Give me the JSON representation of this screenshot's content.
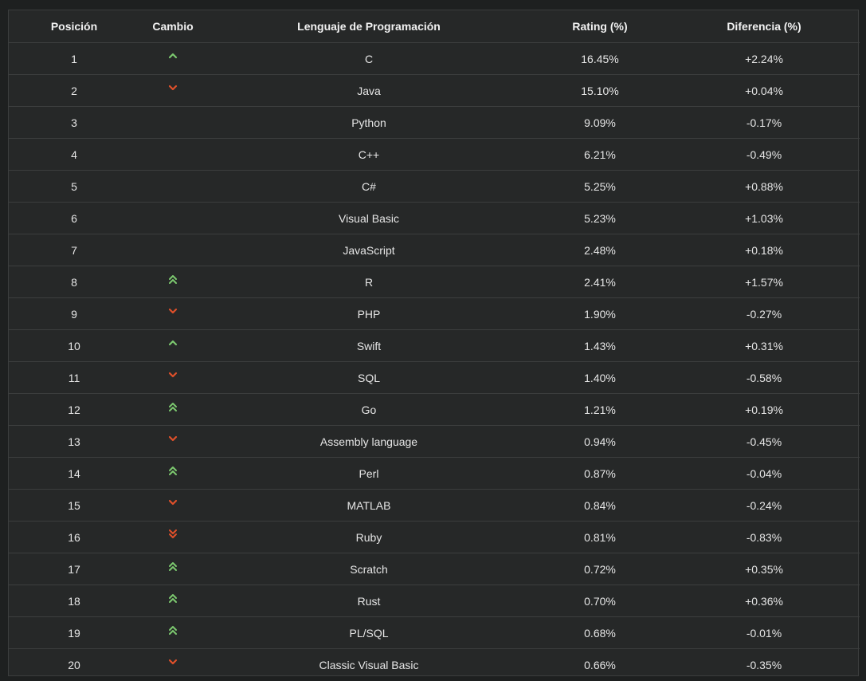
{
  "table": {
    "headers": {
      "position": "Posición",
      "change": "Cambio",
      "language": "Lenguaje de Programación",
      "rating": "Rating (%)",
      "difference": "Diferencia (%)"
    },
    "rows": [
      {
        "position": "1",
        "change": "up",
        "language": "C",
        "rating": "16.45%",
        "difference": "+2.24%"
      },
      {
        "position": "2",
        "change": "down",
        "language": "Java",
        "rating": "15.10%",
        "difference": "+0.04%"
      },
      {
        "position": "3",
        "change": "none",
        "language": "Python",
        "rating": "9.09%",
        "difference": "-0.17%"
      },
      {
        "position": "4",
        "change": "none",
        "language": "C++",
        "rating": "6.21%",
        "difference": "-0.49%"
      },
      {
        "position": "5",
        "change": "none",
        "language": "C#",
        "rating": "5.25%",
        "difference": "+0.88%"
      },
      {
        "position": "6",
        "change": "none",
        "language": "Visual Basic",
        "rating": "5.23%",
        "difference": "+1.03%"
      },
      {
        "position": "7",
        "change": "none",
        "language": "JavaScript",
        "rating": "2.48%",
        "difference": "+0.18%"
      },
      {
        "position": "8",
        "change": "double-up",
        "language": "R",
        "rating": "2.41%",
        "difference": "+1.57%"
      },
      {
        "position": "9",
        "change": "down",
        "language": "PHP",
        "rating": "1.90%",
        "difference": "-0.27%"
      },
      {
        "position": "10",
        "change": "up",
        "language": "Swift",
        "rating": "1.43%",
        "difference": "+0.31%"
      },
      {
        "position": "11",
        "change": "down",
        "language": "SQL",
        "rating": "1.40%",
        "difference": "-0.58%"
      },
      {
        "position": "12",
        "change": "double-up",
        "language": "Go",
        "rating": "1.21%",
        "difference": "+0.19%"
      },
      {
        "position": "13",
        "change": "down",
        "language": "Assembly language",
        "rating": "0.94%",
        "difference": "-0.45%"
      },
      {
        "position": "14",
        "change": "double-up",
        "language": "Perl",
        "rating": "0.87%",
        "difference": "-0.04%"
      },
      {
        "position": "15",
        "change": "down",
        "language": "MATLAB",
        "rating": "0.84%",
        "difference": "-0.24%"
      },
      {
        "position": "16",
        "change": "double-down",
        "language": "Ruby",
        "rating": "0.81%",
        "difference": "-0.83%"
      },
      {
        "position": "17",
        "change": "double-up",
        "language": "Scratch",
        "rating": "0.72%",
        "difference": "+0.35%"
      },
      {
        "position": "18",
        "change": "double-up",
        "language": "Rust",
        "rating": "0.70%",
        "difference": "+0.36%"
      },
      {
        "position": "19",
        "change": "double-up",
        "language": "PL/SQL",
        "rating": "0.68%",
        "difference": "-0.01%"
      },
      {
        "position": "20",
        "change": "down",
        "language": "Classic Visual Basic",
        "rating": "0.66%",
        "difference": "-0.35%"
      }
    ]
  },
  "colors": {
    "up": "#7cc96f",
    "down": "#e0502a",
    "background": "#262828",
    "border": "#3c3e3e",
    "text": "#e6e6e6"
  },
  "icons": {
    "up": "chevron-up-icon",
    "double-up": "double-chevron-up-icon",
    "down": "chevron-down-icon",
    "double-down": "double-chevron-down-icon"
  }
}
